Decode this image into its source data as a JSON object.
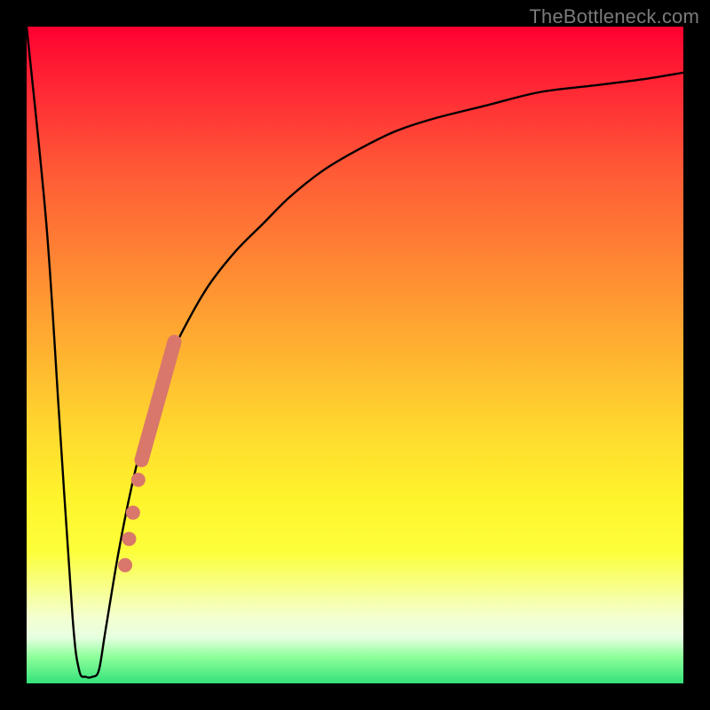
{
  "watermark": "TheBottleneck.com",
  "colors": {
    "frame": "#000000",
    "curve": "#000000",
    "marker": "#d9776b",
    "gradient_top": "#ff0030",
    "gradient_bottom": "#34e27a"
  },
  "chart_data": {
    "type": "line",
    "title": "",
    "xlabel": "",
    "ylabel": "",
    "xlim": [
      0,
      100
    ],
    "ylim": [
      0,
      100
    ],
    "grid": false,
    "legend": false,
    "annotations": [],
    "series": [
      {
        "name": "bottleneck-curve",
        "x": [
          0,
          3,
          5,
          7,
          8,
          9,
          10,
          11,
          12,
          14,
          16,
          18,
          20,
          22,
          25,
          28,
          32,
          36,
          40,
          45,
          50,
          56,
          62,
          70,
          78,
          86,
          94,
          100
        ],
        "y": [
          100,
          70,
          40,
          10,
          2,
          1,
          1,
          2,
          8,
          20,
          30,
          38,
          44,
          50,
          56,
          61,
          66,
          70,
          74,
          78,
          81,
          84,
          86,
          88,
          90,
          91,
          92,
          93
        ]
      }
    ],
    "markers": {
      "name": "highlight-dots",
      "color": "#d9776b",
      "points": [
        {
          "x": 15.0,
          "y": 18
        },
        {
          "x": 15.6,
          "y": 22
        },
        {
          "x": 16.2,
          "y": 26
        },
        {
          "x": 17.0,
          "y": 31
        }
      ],
      "thick_segment": {
        "x_start": 17.5,
        "y_start": 34,
        "x_end": 22.5,
        "y_end": 52
      }
    }
  }
}
